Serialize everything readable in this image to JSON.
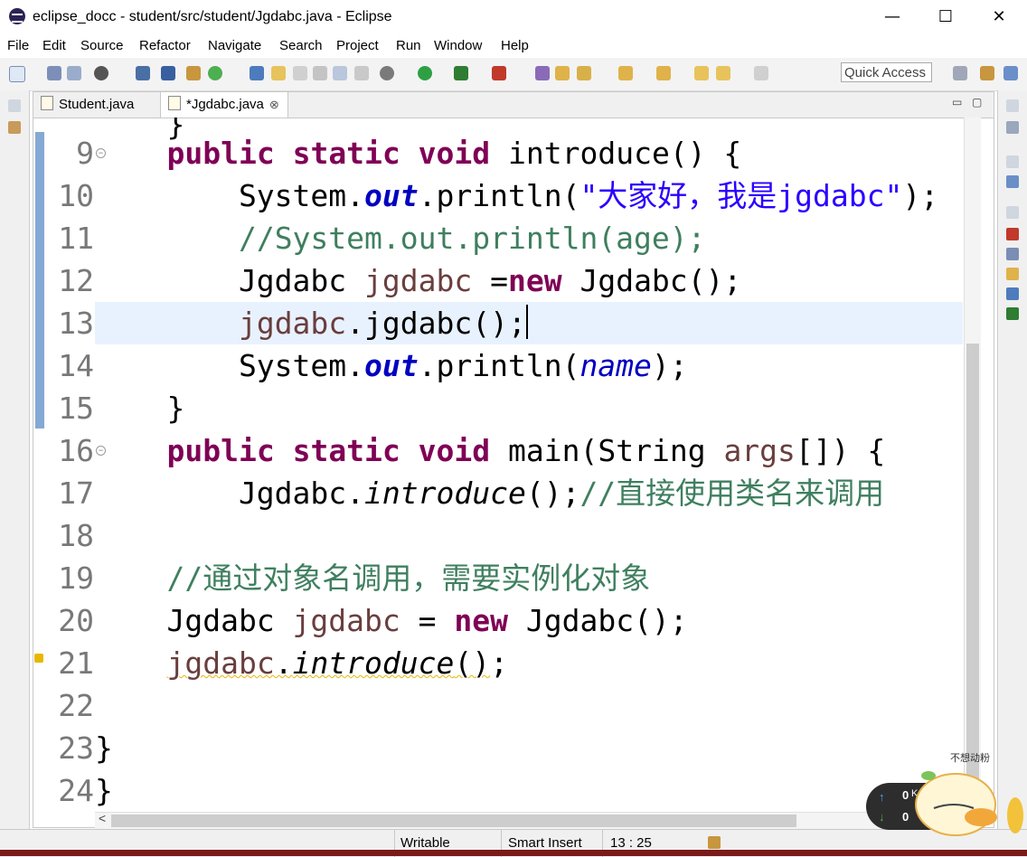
{
  "window": {
    "title": "eclipse_docc - student/src/student/Jgdabc.java - Eclipse",
    "minimize": "—",
    "maximize": "☐",
    "close": "✕"
  },
  "menu": [
    "File",
    "Edit",
    "Source",
    "Refactor",
    "Navigate",
    "Search",
    "Project",
    "Run",
    "Window",
    "Help"
  ],
  "toolbar": {
    "quick_access": "Quick Access"
  },
  "tabs": [
    {
      "label": "Student.java",
      "active": false
    },
    {
      "label": "*Jgdabc.java",
      "active": true,
      "close": "⊗"
    }
  ],
  "editor": {
    "line_numbers": [
      "9",
      "10",
      "11",
      "12",
      "13",
      "14",
      "15",
      "16",
      "17",
      "18",
      "19",
      "20",
      "21",
      "22",
      "23",
      "24"
    ],
    "current_line": "13",
    "scroll_left_arrow": "<"
  },
  "status": {
    "mode": "Writable",
    "insert": "Smart Insert",
    "position": "13 : 25"
  },
  "net_widget": {
    "up": "0",
    "down": "0",
    "up_unit": "K/"
  },
  "mascot_text": "不想动粉"
}
